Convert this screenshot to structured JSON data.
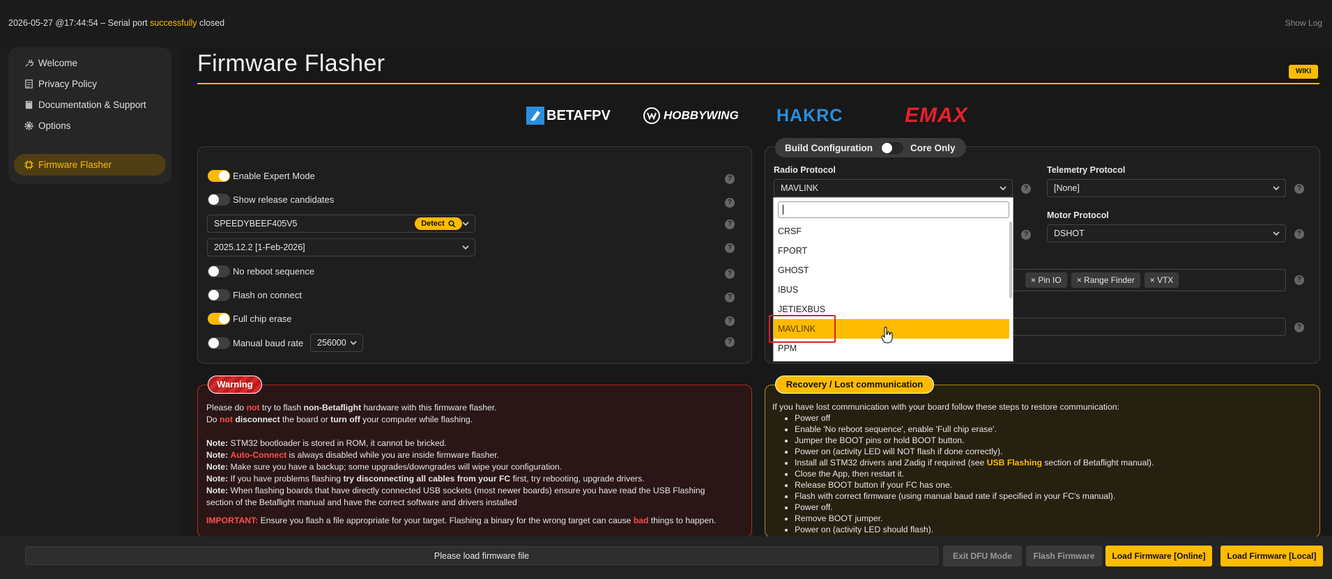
{
  "status": {
    "prefix": "2026-05-27 @17:44:54 – Serial port ",
    "highlight": "successfully",
    "suffix": " closed"
  },
  "show_log": "Show Log",
  "sidebar": {
    "items": [
      {
        "label": "Welcome",
        "icon": "plug-icon"
      },
      {
        "label": "Privacy Policy",
        "icon": "document-icon"
      },
      {
        "label": "Documentation & Support",
        "icon": "book-icon"
      },
      {
        "label": "Options",
        "icon": "gear-icon"
      },
      {
        "label": "Firmware Flasher",
        "icon": "chip-icon",
        "active": true
      }
    ]
  },
  "page": {
    "title": "Firmware Flasher",
    "wiki": "WIKI"
  },
  "logos": [
    "BETAFPV",
    "HOBBYWING",
    "HAKRC",
    "EMAX"
  ],
  "options": {
    "expert_mode": "Enable Expert Mode",
    "release_candidates": "Show release candidates",
    "board": "SPEEDYBEEF405V5",
    "detect": "Detect",
    "version": "2025.12.2 [1-Feb-2026]",
    "no_reboot": "No reboot sequence",
    "flash_on_connect": "Flash on connect",
    "full_chip_erase": "Full chip erase",
    "manual_baud": "Manual baud rate",
    "baud_value": "256000"
  },
  "build": {
    "label": "Build Configuration",
    "core_only": "Core Only",
    "radio_label": "Radio Protocol",
    "radio_value": "MAVLINK",
    "telemetry_label": "Telemetry Protocol",
    "telemetry_value": "[None]",
    "motor_label": "Motor Protocol",
    "motor_value": "DSHOT",
    "tags": [
      "× Pin IO",
      "× Range Finder",
      "× VTX"
    ],
    "dropdown": [
      "CRSF",
      "FPORT",
      "GHOST",
      "IBUS",
      "JETIEXBUS",
      "MAVLINK",
      "PPM"
    ]
  },
  "warning": {
    "title": "Warning",
    "p1a": "Please do ",
    "p1b": "not",
    "p1c": " try to flash ",
    "p1d": "non-Betaflight",
    "p1e": " hardware with this firmware flasher.",
    "p2a": "Do ",
    "p2b": "not",
    "p2c": " ",
    "p2d": "disconnect",
    "p2e": " the board or ",
    "p2f": "turn off",
    "p2g": " your computer while flashing.",
    "note": "Note:",
    "n1": " STM32 bootloader is stored in ROM, it cannot be bricked.",
    "n2a": " ",
    "n2b": "Auto-Connect",
    "n2c": " is always disabled while you are inside firmware flasher.",
    "n3": " Make sure you have a backup; some upgrades/downgrades will wipe your configuration.",
    "n4a": " If you have problems flashing ",
    "n4b": "try disconnecting all cables from your FC",
    "n4c": " first, try rebooting, upgrade drivers.",
    "n5a": " When flashing boards that have directly connected USB sockets (most newer boards) ensure you have read the USB Flashing",
    "n5b": "section of the Betaflight manual and have the correct software and drivers installed",
    "imp": "IMPORTANT:",
    "imp_a": " Ensure you flash a file appropriate for your target. Flashing a binary for the wrong target can cause ",
    "imp_b": "bad",
    "imp_c": " things to happen."
  },
  "recovery": {
    "title": "Recovery / Lost communication",
    "intro": "If you have lost communication with your board follow these steps to restore communication:",
    "steps": [
      "Power off",
      "Enable 'No reboot sequence', enable 'Full chip erase'.",
      "Jumper the BOOT pins or hold BOOT button.",
      "Power on (activity LED will NOT flash if done correctly).",
      "Install all STM32 drivers and Zadig if required (see ",
      "Close the App, then restart it.",
      "Release BOOT button if your FC has one.",
      "Flash with correct firmware (using manual baud rate if specified in your FC's manual).",
      "Power off.",
      "Remove BOOT jumper.",
      "Power on (activity LED should flash)."
    ],
    "usb": "USB Flashing",
    "step5_tail": " section of Betaflight manual)."
  },
  "footer": {
    "progress": "Please load firmware file",
    "exit_dfu": "Exit DFU Mode",
    "flash": "Flash Firmware",
    "load_online": "Load Firmware [Online]",
    "load_local": "Load Firmware [Local]"
  },
  "colors": {
    "accent": "#ffbb00",
    "warning_border": "#d33a3a",
    "selection_outline": "#e02020"
  }
}
